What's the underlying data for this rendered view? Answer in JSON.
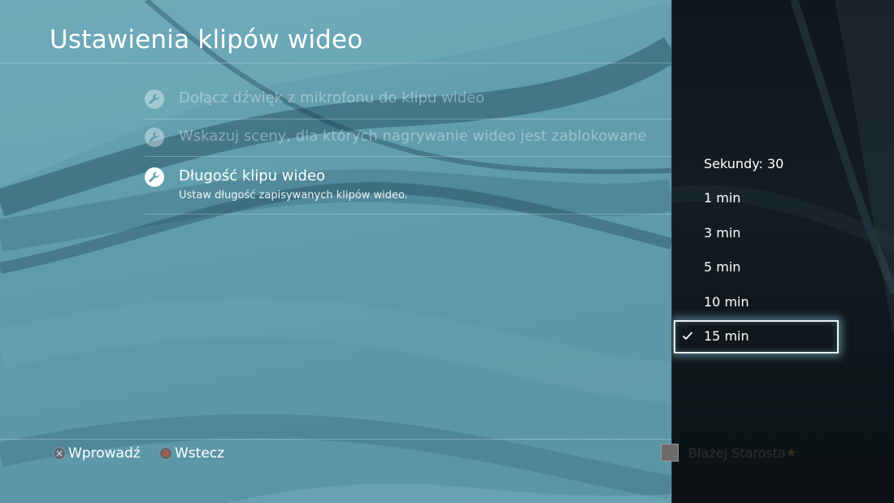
{
  "header": {
    "title": "Ustawienia klipów wideo"
  },
  "menu": {
    "items": [
      {
        "label": "Dołącz dźwięk z mikrofonu do klipu wideo",
        "state": "disabled",
        "icon": "wrench-icon"
      },
      {
        "label": "Wskazuj sceny, dla których nagrywanie wideo jest zablokowane",
        "state": "disabled",
        "icon": "wrench-icon"
      },
      {
        "label": "Długość klipu wideo",
        "description": "Ustaw długość zapisywanych klipów wideo.",
        "state": "active",
        "icon": "wrench-icon"
      }
    ]
  },
  "panel": {
    "options": [
      "Sekundy: 30",
      "1 min",
      "3 min",
      "5 min",
      "10 min",
      "15 min"
    ],
    "selected": "15 min"
  },
  "footer": {
    "enter_label": "Wprowadź",
    "back_label": "Wstecz"
  },
  "user": {
    "name": "Błażej Starosta"
  },
  "colors": {
    "background": "#5e9bab",
    "panel": "#121c22",
    "focus": "#e8f3f6",
    "cross_button": "#5b6a73",
    "circle_button": "#b05a4a"
  }
}
